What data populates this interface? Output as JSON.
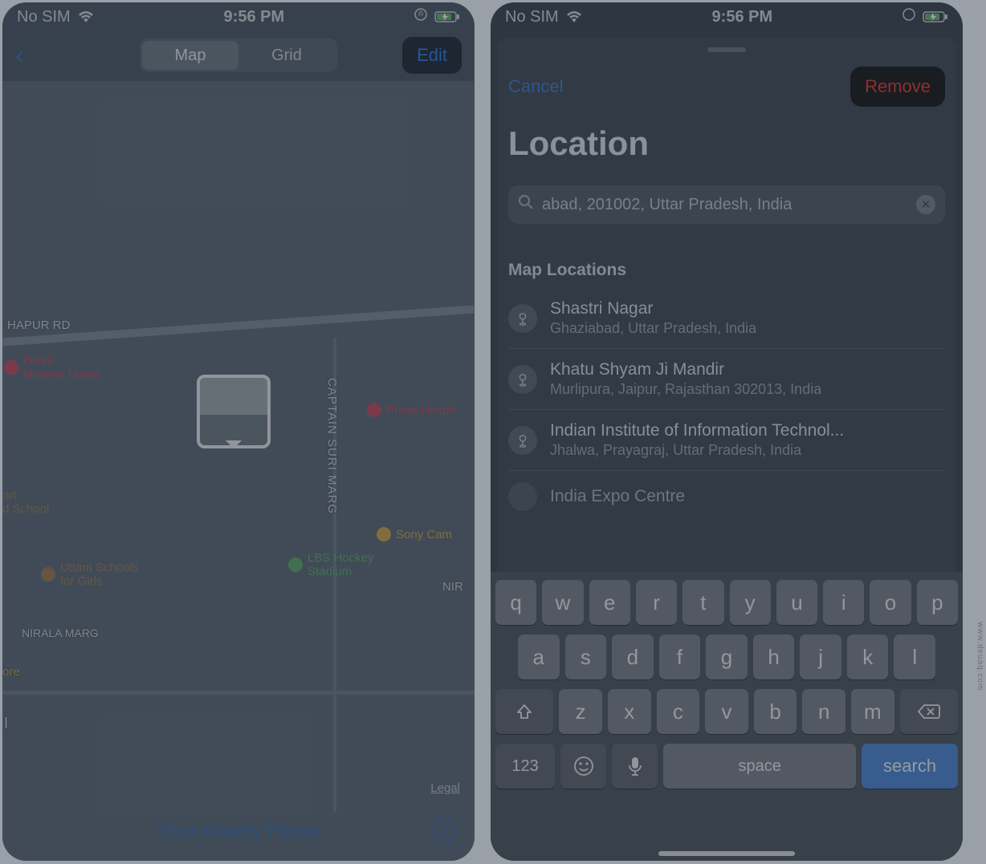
{
  "status_bar": {
    "carrier": "No SIM",
    "time": "9:56 PM"
  },
  "left": {
    "segments": {
      "map": "Map",
      "grid": "Grid"
    },
    "edit": "Edit",
    "street_labels": {
      "hapur_rd": "HAPUR RD",
      "captain_suri": "CAPTAIN SURI MARG",
      "nirala": "NIRALA MARG"
    },
    "pois": {
      "divya": "Divya\nNursing Home",
      "prime": "Prime Hospit",
      "fort": "ort\nd School",
      "sony": "Sony Cam",
      "lbs": "LBS Hockey\nStadium",
      "uttam": "Uttam Schools\nfor Girls",
      "nir": "NIR",
      "i": "I",
      "ore": "ore"
    },
    "legal": "Legal",
    "show_nearby": "Show Nearby Photos"
  },
  "right": {
    "cancel": "Cancel",
    "remove": "Remove",
    "title": "Location",
    "search_value": "abad, 201002, Uttar Pradesh, India",
    "section": "Map Locations",
    "results": [
      {
        "title": "Shastri Nagar",
        "subtitle": "Ghaziabad, Uttar Pradesh, India"
      },
      {
        "title": "Khatu Shyam Ji Mandir",
        "subtitle": "Murlipura, Jaipur, Rajasthan 302013, India"
      },
      {
        "title": "Indian Institute of Information Technol...",
        "subtitle": "Jhalwa, Prayagraj, Uttar Pradesh, India"
      },
      {
        "title": "India Expo Centre",
        "subtitle": ""
      }
    ]
  },
  "keyboard": {
    "row1": [
      "q",
      "w",
      "e",
      "r",
      "t",
      "y",
      "u",
      "i",
      "o",
      "p"
    ],
    "row2": [
      "a",
      "s",
      "d",
      "f",
      "g",
      "h",
      "j",
      "k",
      "l"
    ],
    "row3": [
      "z",
      "x",
      "c",
      "v",
      "b",
      "n",
      "m"
    ],
    "n123": "123",
    "space": "space",
    "search": "search"
  },
  "watermark": "www.deuaq.com"
}
